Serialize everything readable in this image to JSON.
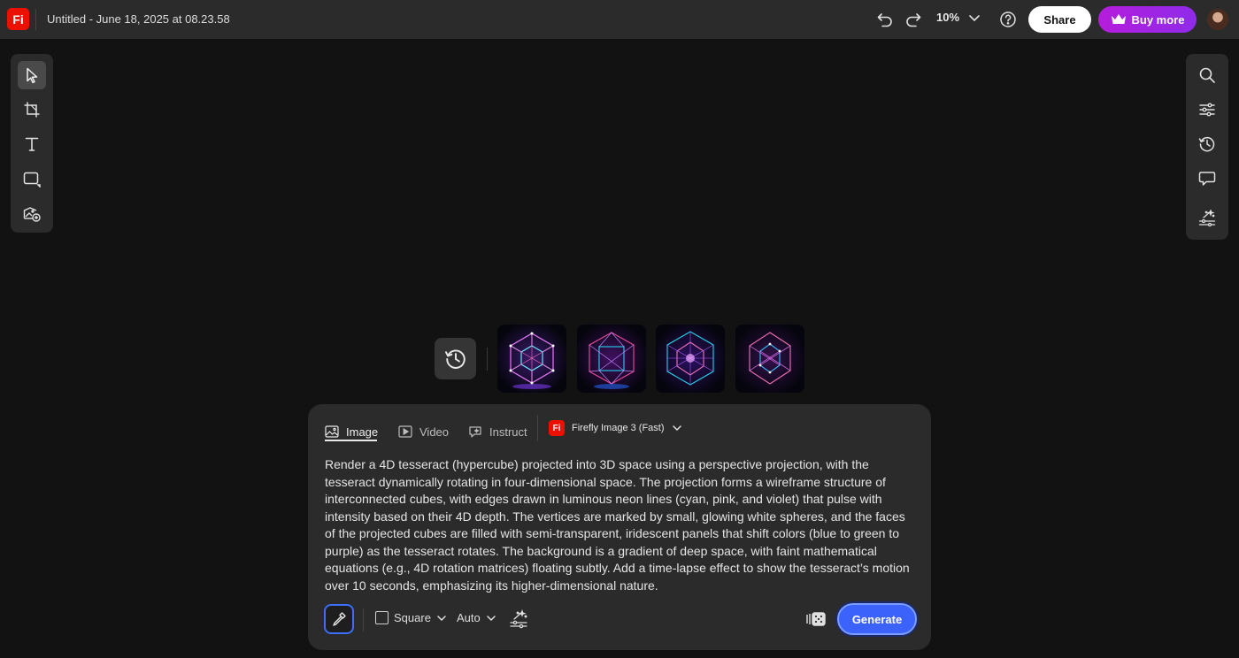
{
  "header": {
    "app_logo": "Fi",
    "doc_title": "Untitled - June 18, 2025 at 08.23.58",
    "zoom": "10%",
    "share_label": "Share",
    "buy_label": "Buy more"
  },
  "colors": {
    "accent_blue": "#3b63fb",
    "brand_red": "#eb1000",
    "buy_purple": "#b41ddb"
  },
  "left_tools": [
    "select-icon",
    "crop-icon",
    "text-icon",
    "shape-icon",
    "generate-image-icon"
  ],
  "right_tools": [
    "search-icon",
    "adjustments-icon",
    "history-icon",
    "comment-icon",
    "effects-icon"
  ],
  "thumbnails": {
    "count": 4
  },
  "prompt_panel": {
    "tabs": [
      {
        "label": "Image",
        "active": true
      },
      {
        "label": "Video",
        "active": false
      },
      {
        "label": "Instruct",
        "active": false
      }
    ],
    "model": {
      "logo": "Fi",
      "label": "Firefly Image 3 (Fast)"
    },
    "prompt": "Render a 4D tesseract (hypercube) projected into 3D space using a perspective projection, with the tesseract dynamically rotating in four-dimensional space. The projection forms a wireframe structure of interconnected cubes, with edges drawn in luminous neon lines (cyan, pink, and violet) that pulse with intensity based on their 4D depth. The vertices are marked by small, glowing white spheres, and the faces of the projected cubes are filled with semi-transparent, iridescent panels that shift colors (blue to green to purple) as the tesseract rotates. The background is a gradient of deep space, with faint mathematical equations (e.g., 4D rotation matrices) floating subtly. Add a time-lapse effect to show the tesseract’s motion over 10 seconds, emphasizing its higher-dimensional nature.",
    "aspect_label": "Square",
    "content_type_label": "Auto",
    "generate_label": "Generate"
  }
}
